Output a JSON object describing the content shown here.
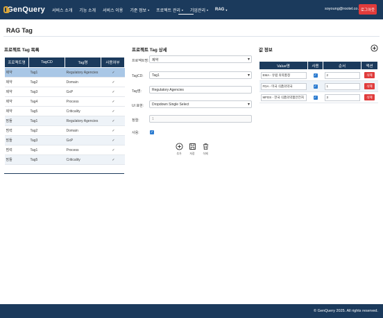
{
  "app": {
    "logo_text": "GenQuery"
  },
  "nav": {
    "items": [
      {
        "label": "서비스 소개",
        "caret": ""
      },
      {
        "label": "기능 소개",
        "caret": ""
      },
      {
        "label": "서비스 이용",
        "caret": ""
      },
      {
        "label": "기준 정보",
        "caret": "▾"
      },
      {
        "label": "프로젝트 관리",
        "caret": "▾"
      },
      {
        "label": "기업관리",
        "caret": "▾"
      },
      {
        "label": "RAG",
        "caret": "▾"
      }
    ],
    "user_email": "soyoung@rootel.co.kr",
    "logout_label": "로그아웃"
  },
  "page": {
    "title": "RAG Tag"
  },
  "tag_list": {
    "title": "프로젝트 Tag 목록",
    "columns": [
      "프로젝트명",
      "TagCD",
      "Tag명",
      "사용여부"
    ],
    "rows": [
      [
        "제약",
        "Tag1",
        "Regulatory Agencies",
        "✓"
      ],
      [
        "제약",
        "Tag2",
        "Domain",
        "✓"
      ],
      [
        "제약",
        "Tag3",
        "GxP",
        "✓"
      ],
      [
        "제약",
        "Tag4",
        "Process",
        "✓"
      ],
      [
        "제약",
        "Tag5",
        "Criticality",
        "✓"
      ],
      [
        "맘들",
        "Tag1",
        "Regulatory Agencies",
        "✓"
      ],
      [
        "범력",
        "Tag2",
        "Domain",
        "✓"
      ],
      [
        "맘들",
        "Tag3",
        "GxP",
        "✓"
      ],
      [
        "범력",
        "Tag1",
        "Process",
        "✓"
      ],
      [
        "맘들",
        "Tag5",
        "Criticality",
        "✓"
      ]
    ]
  },
  "detail": {
    "title": "프로젝트 Tag 상세",
    "project_label": "프로젝트명:",
    "project_value": "제약",
    "tagcd_label": "TagCD:",
    "tagcd_value": "Tag1",
    "tagname_label": "Tag명:",
    "tagname_value": "Regulatory Agencies",
    "ui_label": "UI 표현:",
    "ui_value": "Dropdown Single Select",
    "order_label": "정렬:",
    "order_value": "1",
    "use_label": "사용:",
    "use_check": "✓",
    "actions": {
      "add": "추가",
      "save": "저장",
      "delete": "삭제"
    }
  },
  "values": {
    "title": "값 정보",
    "columns": [
      "Value명",
      "사용",
      "순서",
      "액션"
    ],
    "rows": [
      {
        "name": "EMA - 유럽 의약품청",
        "use": "✓",
        "order": "2",
        "action": "삭제"
      },
      {
        "name": "FDA - 미국 식품의약국",
        "use": "✓",
        "order": "1",
        "action": "삭제"
      },
      {
        "name": "MFDS - 한국 식품의약품안전처",
        "use": "✓",
        "order": "3",
        "action": "삭제"
      }
    ]
  },
  "footer": {
    "text": "© GenQuery 2025. All rights reserved."
  }
}
